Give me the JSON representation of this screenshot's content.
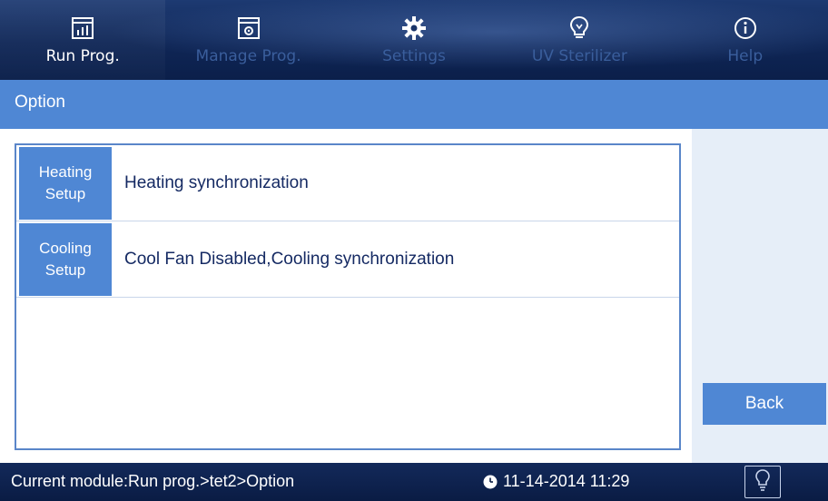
{
  "nav": {
    "tabs": [
      {
        "label": "Run Prog.",
        "icon": "chart-window-icon",
        "active": true
      },
      {
        "label": "Manage Prog.",
        "icon": "program-window-icon",
        "active": false
      },
      {
        "label": "Settings",
        "icon": "gear-icon",
        "active": false
      },
      {
        "label": "UV Sterilizer",
        "icon": "lightbulb-icon",
        "active": false
      },
      {
        "label": "Help",
        "icon": "info-icon",
        "active": false
      }
    ]
  },
  "page": {
    "title": "Option"
  },
  "options": {
    "rows": [
      {
        "heading": "Heating\nSetup",
        "value": "Heating synchronization"
      },
      {
        "heading": "Cooling\nSetup",
        "value": "Cool Fan Disabled,Cooling synchronization"
      }
    ]
  },
  "actions": {
    "back_label": "Back"
  },
  "status": {
    "module": "Current module:Run prog.>tet2>Option",
    "datetime": "11-14-2014 11:29"
  },
  "colors": {
    "nav_bg": "#0f2656",
    "accent": "#4f87d4",
    "text_dark": "#152a63"
  }
}
